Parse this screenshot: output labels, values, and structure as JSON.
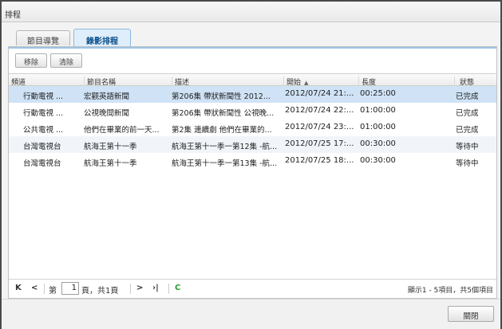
{
  "window": {
    "title": "排程"
  },
  "tabs": [
    {
      "label": "節目導覽",
      "active": false
    },
    {
      "label": "錄影排程",
      "active": true
    }
  ],
  "toolbar": {
    "remove_label": "移除",
    "clear_label": "清除"
  },
  "columns": {
    "channel": "頻道",
    "program": "節目名稱",
    "description": "描述",
    "start": "開始",
    "duration": "長度",
    "status": "狀態",
    "sort_indicator": "▲"
  },
  "rows": [
    {
      "channel": "行動電視 ...",
      "program": "宏觀英語新聞",
      "description": "第206集 帶狀新聞性 2012...",
      "start": "2012/07/24 21:...",
      "duration": "00:25:00",
      "status": "已完成"
    },
    {
      "channel": "行動電視 ...",
      "program": "公視晚間新聞",
      "description": "第206集 帶狀新聞性 公視晚...",
      "start": "2012/07/24 22:...",
      "duration": "01:00:00",
      "status": "已完成"
    },
    {
      "channel": "公共電視 ...",
      "program": "他們在畢業的前一天...",
      "description": "第2集 連續劇 他們在畢業的...",
      "start": "2012/07/24 23:...",
      "duration": "01:00:00",
      "status": "已完成"
    },
    {
      "channel": "台灣電視台",
      "program": "航海王第十一季",
      "description": "航海王第十一季一第12集 -航...",
      "start": "2012/07/25 17:...",
      "duration": "00:30:00",
      "status": "等待中"
    },
    {
      "channel": "台灣電視台",
      "program": "航海王第十一季",
      "description": "航海王第十一季一第13集 -航...",
      "start": "2012/07/25 18:...",
      "duration": "00:30:00",
      "status": "等待中"
    }
  ],
  "pager": {
    "first_icon": "K",
    "prev_icon": "<",
    "page_prefix": "第",
    "current_page": "1",
    "page_suffix": "頁，共1頁",
    "next_icon": ">",
    "last_icon": "›|",
    "refresh_icon": "C",
    "summary": "顯示1 - 5項目，共5個項目"
  },
  "footer": {
    "close_label": "關閉"
  },
  "colors": {
    "selected_row": "#cfe2f6",
    "active_tab": "#0b4f8a",
    "refresh": "#2f9a2f"
  }
}
